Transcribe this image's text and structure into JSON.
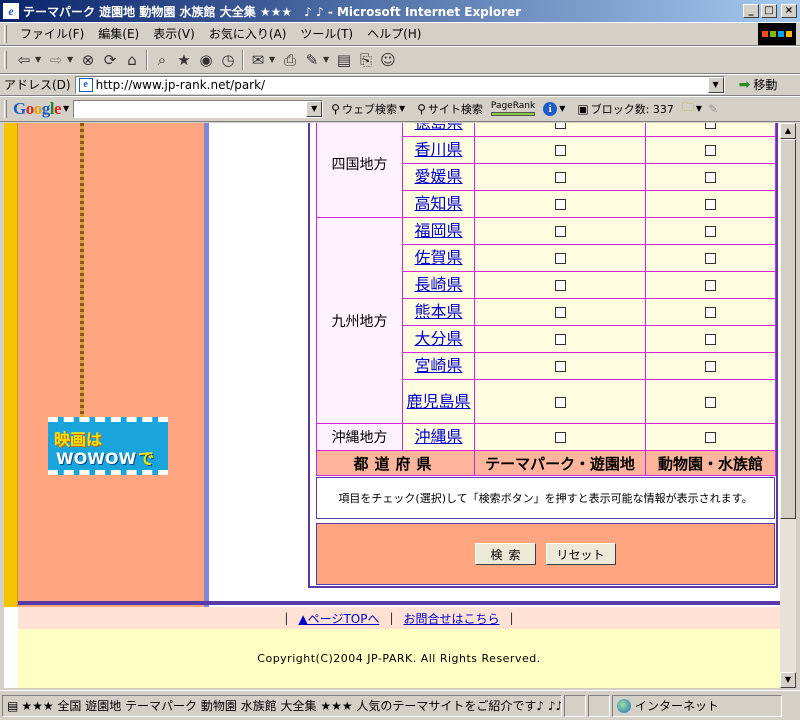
{
  "window": {
    "title": "テーマパーク 遊園地 動物園 水族館 大全集 ★★★　♪ ♪ - Microsoft Internet Explorer",
    "controls": {
      "minimize": "_",
      "maximize": "□",
      "close": "×"
    }
  },
  "menu": {
    "items": [
      "ファイル(F)",
      "編集(E)",
      "表示(V)",
      "お気に入り(A)",
      "ツール(T)",
      "ヘルプ(H)"
    ]
  },
  "address": {
    "label": "アドレス(D)",
    "url": "http://www.jp-rank.net/park/",
    "go_label": "移動"
  },
  "googlebar": {
    "web_search": "ウェブ検索",
    "site_search": "サイト検索",
    "pagerank": "PageRank",
    "popup_blocked": "ブロック数: 337"
  },
  "table": {
    "rows": [
      {
        "region": "四国地方",
        "pref": "徳島県"
      },
      {
        "region": "",
        "pref": "香川県"
      },
      {
        "region": "",
        "pref": "愛媛県"
      },
      {
        "region": "",
        "pref": "高知県"
      },
      {
        "region": "九州地方",
        "pref": "福岡県"
      },
      {
        "region": "",
        "pref": "佐賀県"
      },
      {
        "region": "",
        "pref": "長崎県"
      },
      {
        "region": "",
        "pref": "熊本県"
      },
      {
        "region": "",
        "pref": "大分県"
      },
      {
        "region": "",
        "pref": "宮崎県"
      },
      {
        "region": "",
        "pref": "鹿児島県"
      },
      {
        "region": "沖縄地方",
        "pref": "沖縄県"
      }
    ],
    "header": {
      "pref": "都道府県",
      "themepark": "テーマパーク・遊園地",
      "zoo": "動物園・水族館"
    }
  },
  "note": "項目をチェック(選択)して「検索ボタン」を押すと表示可能な情報が表示されます。",
  "buttons": {
    "search": "検索",
    "reset": "リセット"
  },
  "ad": {
    "line1": "映画は",
    "line2": "WOWOW",
    "line2_suffix": "で"
  },
  "footer": {
    "pipe": "|",
    "page_top": "▲ページTOPへ",
    "contact": "お問合せはこちら",
    "copyright": "Copyright(C)2004 JP-PARK. All Rights Reserved."
  },
  "status": {
    "text": "★★★ 全国 遊園地 テーマパーク 動物園 水族館 大全集 ★★★ 人気のテーマサイトをご紹介です♪ ♪♪(",
    "zone": "インターネット"
  }
}
